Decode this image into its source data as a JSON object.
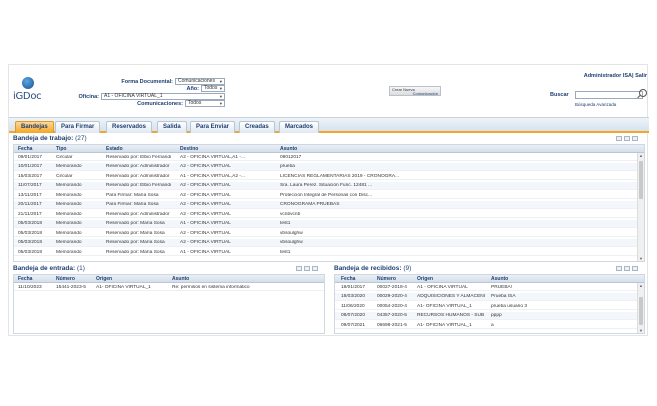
{
  "header": {
    "logo_text": "iGDoc",
    "forma_label": "Forma Documental:",
    "forma_value": "Comunicaciones",
    "anio_label": "Año:",
    "anio_value": "Todos",
    "oficina_label": "Oficina:",
    "oficina_value": "A1 - OFICINA VIRTUAL_1",
    "comunicaciones_label": "Comunicaciones:",
    "comunicaciones_value": "Todos",
    "crear_line1": "Crear Nueva",
    "crear_line2": "Comunicación",
    "user": "Administrador ISA| Salir",
    "buscar_label": "Buscar",
    "busqueda_avanzada": "Búsqueda Avanzada"
  },
  "tabs": [
    "Bandejas",
    "Para Firmar",
    "Reservados",
    "Salida",
    "Para Enviar",
    "Creadas",
    "Marcados"
  ],
  "trabajo": {
    "title": "Bandeja de trabajo:",
    "count": "(27)",
    "columns": [
      "Fecha",
      "Tipo",
      "Estado",
      "Destino",
      "Asunto"
    ],
    "rows": [
      [
        "09/01/2017",
        "Circular",
        "Reservado por: Elbio Fernandi",
        "A2 - OFICINA VIRTUAL,A1 -...",
        "09012017"
      ],
      [
        "10/01/2017",
        "Memorando",
        "Reservado por: Administrador",
        "A2 - OFICINA VIRTUAL",
        "prueba"
      ],
      [
        "15/03/2017",
        "Circular",
        "Reservado por: Administrador",
        "A1 - OFICINA VIRTUAL,A2 -...",
        "LICENCIAS REGLAMENTARIAS 2019 - CRONOGRA..."
      ],
      [
        "11/07/2017",
        "Memorando",
        "Reservado por: Elbio Fernandi",
        "A2 - OFICINA VIRTUAL",
        "Sra. Laura Perez. Situación Func. 12481 ..."
      ],
      [
        "13/11/2017",
        "Memorando",
        "Para Firmar: María Sosa",
        "A2 - OFICINA VIRTUAL",
        "Protección Integral de Personas con Disc..."
      ],
      [
        "20/11/2017",
        "Memorando",
        "Para Firmar: María Sosa",
        "A2 - OFICINA VIRTUAL",
        "CRONOGRAMA PRUEBAS"
      ],
      [
        "21/11/2017",
        "Memorando",
        "Reservado por: Administrador",
        "A2 - OFICINA VIRTUAL",
        "vcnbvcnb"
      ],
      [
        "05/03/2018",
        "Memorando",
        "Reservado por: María Sosa",
        "A1 - OFICINA VIRTUAL",
        "test1"
      ],
      [
        "05/03/2018",
        "Memorando",
        "Reservado por: María Sosa",
        "A2 - OFICINA VIRTUAL",
        "vbsoulghw"
      ],
      [
        "05/03/2018",
        "Memorando",
        "Reservado por: María Sosa",
        "A2 - OFICINA VIRTUAL",
        "vbsoulghw"
      ],
      [
        "05/03/2018",
        "Memorando",
        "Reservado por: María Sosa",
        "A1 - OFICINA VIRTUAL",
        "test1"
      ]
    ]
  },
  "entrada": {
    "title": "Bandeja de entrada:",
    "count": "(1)",
    "columns": [
      "Fecha",
      "Número",
      "Origen",
      "Asunto"
    ],
    "rows": [
      [
        "11/10/2023",
        "15441-2023-5",
        "A1- OFICINA VIRTUAL_1",
        "Re: permisos en sistema informatico"
      ]
    ]
  },
  "recibidos": {
    "title": "Bandeja de recibidos:",
    "count": "(9)",
    "columns": [
      "Fecha",
      "Número",
      "Origen",
      "Asunto"
    ],
    "rows": [
      [
        "18/01/2017",
        "00027-2018-4",
        "A1 - OFICINA VIRTUAL",
        "PRUEBA!"
      ],
      [
        "18/03/2020",
        "00029-2020-4",
        "ADQUISICIONES Y ALMACENI",
        "Prueba ISA"
      ],
      [
        "11/06/2020",
        "00054-2020-4",
        "A1- OFICINA VIRTUAL_1",
        "prueba usuario 3"
      ],
      [
        "08/07/2020",
        "04357-2020-5",
        "RECURSOS HUMANOS - SUB",
        "pppp"
      ],
      [
        "09/07/2021",
        "06698-2021-5",
        "A1- OFICINA VIRTUAL_1",
        "a"
      ]
    ]
  }
}
